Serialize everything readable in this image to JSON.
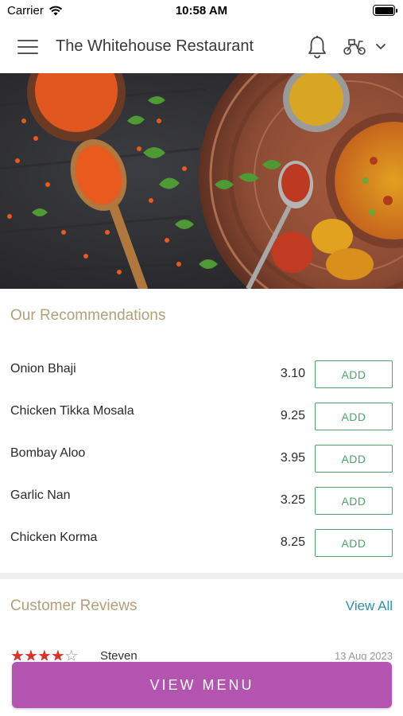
{
  "status_bar": {
    "carrier": "Carrier",
    "time": "10:58 AM"
  },
  "app_bar": {
    "title": "The Whitehouse Restaurant",
    "icons": [
      "menu-icon",
      "bell-icon",
      "scooter-icon",
      "chevron-down-icon"
    ]
  },
  "recommendations": {
    "title": "Our Recommendations",
    "items": [
      {
        "name": "Onion Bhaji",
        "price": "3.10",
        "button": "ADD"
      },
      {
        "name": "Chicken Tikka Mosala",
        "price": "9.25",
        "button": "ADD"
      },
      {
        "name": "Bombay Aloo",
        "price": "3.95",
        "button": "ADD"
      },
      {
        "name": "Garlic Nan",
        "price": "3.25",
        "button": "ADD"
      },
      {
        "name": "Chicken Korma",
        "price": "8.25",
        "button": "ADD"
      }
    ]
  },
  "reviews": {
    "title": "Customer Reviews",
    "view_all": "View All",
    "first": {
      "reviewer": "Steven",
      "date": "13 Aug 2023",
      "rating": 4,
      "max_rating": 5
    }
  },
  "cta": {
    "label": "VIEW MENU"
  },
  "colors": {
    "accent_purple": "#b354b0",
    "add_green": "#4aa66a",
    "section_gold": "#b3a07a",
    "link_blue": "#2e8fb3",
    "star_red": "#d9342c"
  }
}
